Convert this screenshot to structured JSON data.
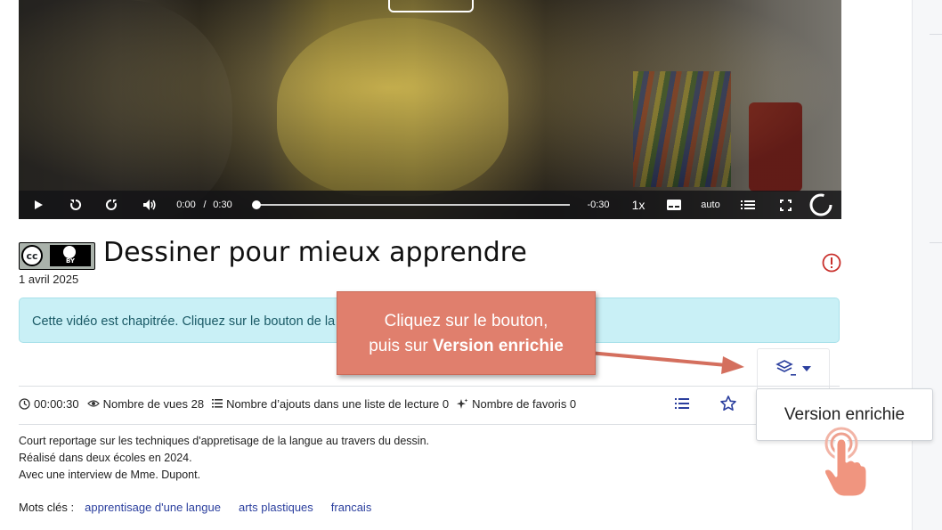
{
  "video": {
    "current_time": "0:00",
    "time_separator": "/",
    "duration": "0:30",
    "remaining": "-0:30",
    "speed": "1x",
    "quality": "auto",
    "progress": 0.0
  },
  "title": "Dessiner pour mieux apprendre",
  "license_badge": "BY",
  "date": "1 avril 2025",
  "alert_text": "Cette vidéo est chapitrée. Cliquez sur le bouton de la vidéo pour les voir.",
  "stats": {
    "duration": "00:00:30",
    "views": "Nombre de vues 28",
    "playlist_adds": "Nombre d’ajouts dans une liste de lecture 0",
    "favorites": "Nombre de favoris 0"
  },
  "description": [
    "Court reportage sur les techniques d'appretisage de la langue au travers du dessin.",
    "Réalisé dans deux écoles en 2024.",
    "Avec une interview de Mme. Dupont."
  ],
  "keywords": {
    "label": "Mots clés :",
    "items": [
      "apprentisage d'une langue",
      "arts plastiques",
      "francais"
    ]
  },
  "callout": {
    "line1": "Cliquez sur le bouton,",
    "line2_prefix": "puis sur ",
    "line2_bold": "Version enrichie"
  },
  "dropdown_item": "Version enrichie",
  "colors": {
    "alert_bg": "#c9f0f6",
    "callout_bg": "#e07f6d",
    "link": "#2b3f9e",
    "accent": "#2b3f9e",
    "report": "#c9302c"
  },
  "icons": [
    "play-icon",
    "replay-icon",
    "forward-icon",
    "volume-icon",
    "subtitles-icon",
    "chapters-icon",
    "fullscreen-icon",
    "loading-icon",
    "report-icon",
    "layers-icon",
    "clock-icon",
    "eye-icon",
    "list-icon",
    "sparkle-icon",
    "star-icon",
    "pointer-hand-icon"
  ]
}
